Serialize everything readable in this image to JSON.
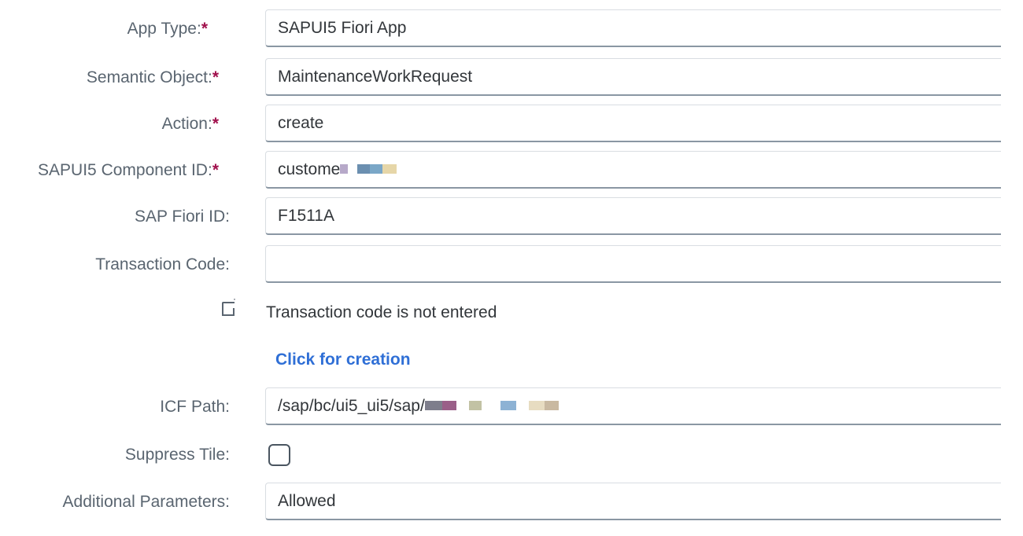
{
  "form": {
    "app_type": {
      "label": "App Type:",
      "required": "*",
      "value": "SAPUI5 Fiori App"
    },
    "semantic_object": {
      "label": "Semantic Object:",
      "required": "*",
      "value": "MaintenanceWorkRequest"
    },
    "action": {
      "label": "Action:",
      "required": "*",
      "value": "create"
    },
    "component_id": {
      "label": "SAPUI5 Component ID:",
      "required": "*",
      "value": "custome"
    },
    "fiori_id": {
      "label": "SAP Fiori ID:",
      "value": "F1511A"
    },
    "transaction_code": {
      "label": "Transaction Code:",
      "value": ""
    },
    "transaction_info": {
      "message": "Transaction code is not entered",
      "icon": "document-add-icon"
    },
    "creation_link": {
      "label": "Click for creation"
    },
    "icf_path": {
      "label": "ICF Path:",
      "value": "/sap/bc/ui5_ui5/sap/"
    },
    "suppress_tile": {
      "label": "Suppress Tile:",
      "checked": false
    },
    "additional_parameters": {
      "label": "Additional Parameters:",
      "value": "Allowed"
    }
  },
  "colors": {
    "required_marker": "#a1114d",
    "link": "#2f6fd6",
    "label": "#5a6570"
  }
}
